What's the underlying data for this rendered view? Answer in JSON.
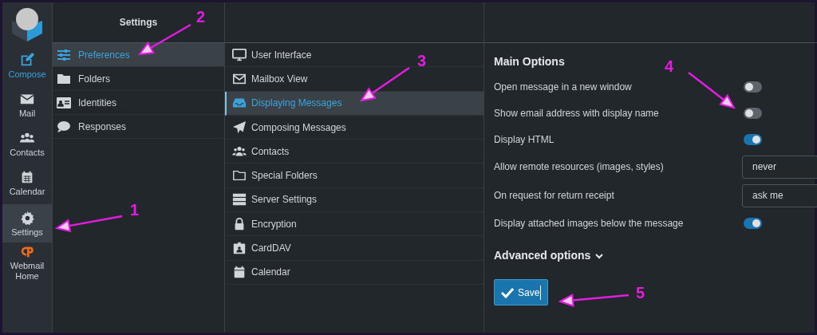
{
  "nav": [
    {
      "label": "Compose",
      "kind": "primary",
      "selected": false
    },
    {
      "label": "Mail",
      "kind": "plain",
      "selected": false
    },
    {
      "label": "Contacts",
      "kind": "plain",
      "selected": false
    },
    {
      "label": "Calendar",
      "kind": "plain",
      "selected": false
    },
    {
      "label": "Settings",
      "kind": "plain",
      "selected": true
    },
    {
      "label": "Webmail Home",
      "kind": "plain",
      "selected": false
    }
  ],
  "settings_list": {
    "title": "Settings",
    "items": [
      {
        "label": "Preferences",
        "selected": true
      },
      {
        "label": "Folders",
        "selected": false
      },
      {
        "label": "Identities",
        "selected": false
      },
      {
        "label": "Responses",
        "selected": false
      }
    ]
  },
  "sections": [
    {
      "label": "User Interface",
      "selected": false
    },
    {
      "label": "Mailbox View",
      "selected": false
    },
    {
      "label": "Displaying Messages",
      "selected": true
    },
    {
      "label": "Composing Messages",
      "selected": false
    },
    {
      "label": "Contacts",
      "selected": false
    },
    {
      "label": "Special Folders",
      "selected": false
    },
    {
      "label": "Server Settings",
      "selected": false
    },
    {
      "label": "Encryption",
      "selected": false
    },
    {
      "label": "CardDAV",
      "selected": false
    },
    {
      "label": "Calendar",
      "selected": false
    }
  ],
  "main": {
    "title": "Main Options",
    "options": [
      {
        "kind": "toggle",
        "label": "Open message in a new window",
        "on": false
      },
      {
        "kind": "toggle",
        "label": "Show email address with display name",
        "on": false
      },
      {
        "kind": "toggle",
        "label": "Display HTML",
        "on": true
      },
      {
        "kind": "select",
        "label": "Allow remote resources (images, styles)",
        "value": "never"
      },
      {
        "kind": "select",
        "label": "On request for return receipt",
        "value": "ask me"
      },
      {
        "kind": "toggle",
        "label": "Display attached images below the message",
        "on": true
      }
    ],
    "advanced": {
      "label": "Advanced options",
      "expanded": false
    },
    "save_button": "Save"
  },
  "annotations": [
    "1",
    "2",
    "3",
    "4",
    "5"
  ]
}
